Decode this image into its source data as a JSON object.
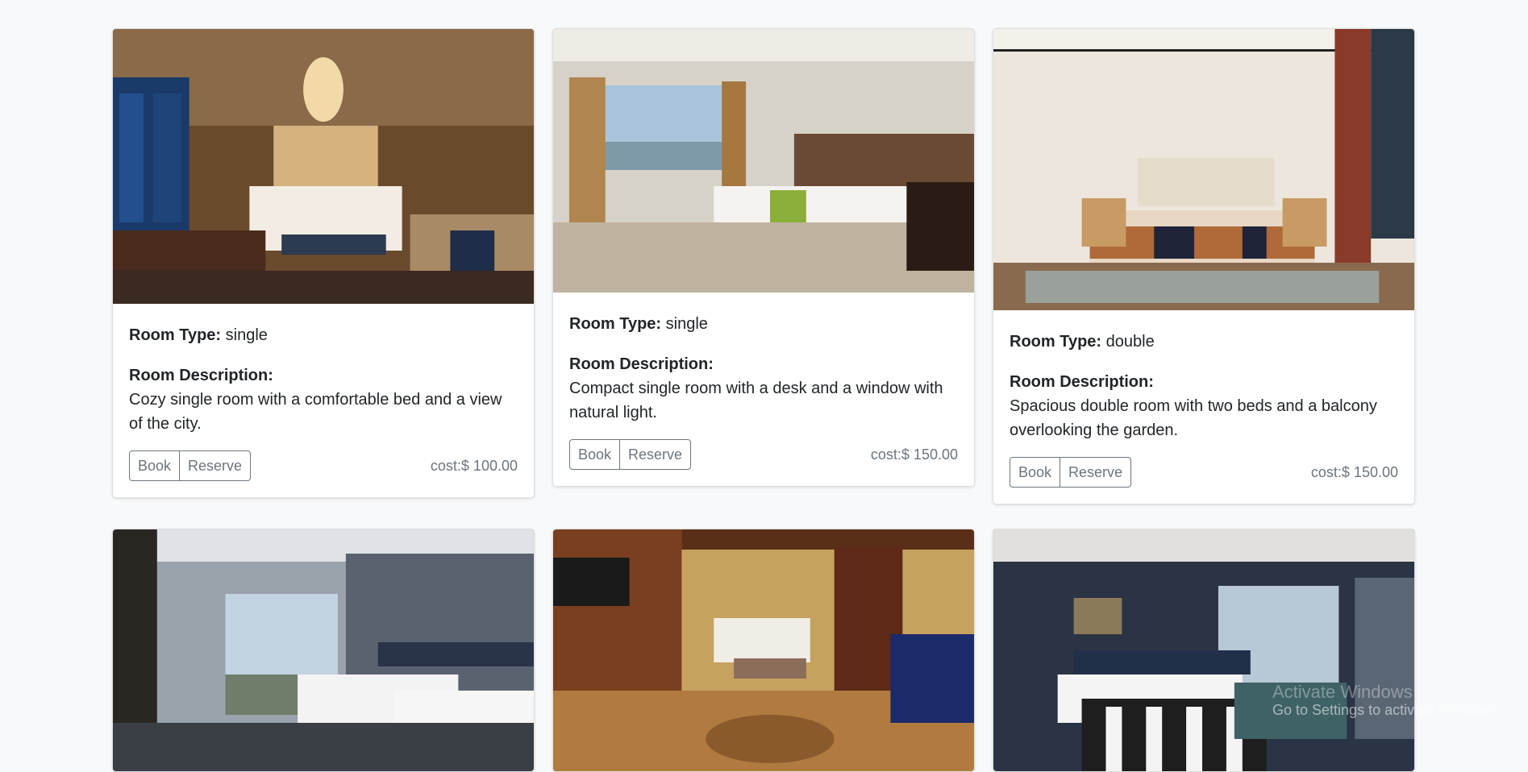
{
  "labels": {
    "room_type": "Room Type:",
    "room_description": "Room Description:",
    "book": "Book",
    "reserve": "Reserve"
  },
  "rooms": [
    {
      "room_type": "single",
      "description": "Cozy single room with a comfortable bed and a view of the city.",
      "cost": "cost:$ 100.00",
      "image_icon": "room-photo-icon"
    },
    {
      "room_type": "single",
      "description": "Compact single room with a desk and a window with natural light.",
      "cost": "cost:$ 150.00",
      "image_icon": "room-photo-icon"
    },
    {
      "room_type": "double",
      "description": "Spacious double room with two beds and a balcony overlooking the garden.",
      "cost": "cost:$ 150.00",
      "image_icon": "room-photo-icon"
    },
    {
      "image_icon": "room-photo-icon"
    },
    {
      "image_icon": "room-photo-icon"
    },
    {
      "image_icon": "room-photo-icon"
    }
  ],
  "watermark": {
    "line1": "Activate Windows",
    "line2": "Go to Settings to activate Windows."
  },
  "colors": {
    "page_background": "#f8f9fa",
    "button_border": "#6c757d",
    "muted_text": "#6c757d"
  }
}
